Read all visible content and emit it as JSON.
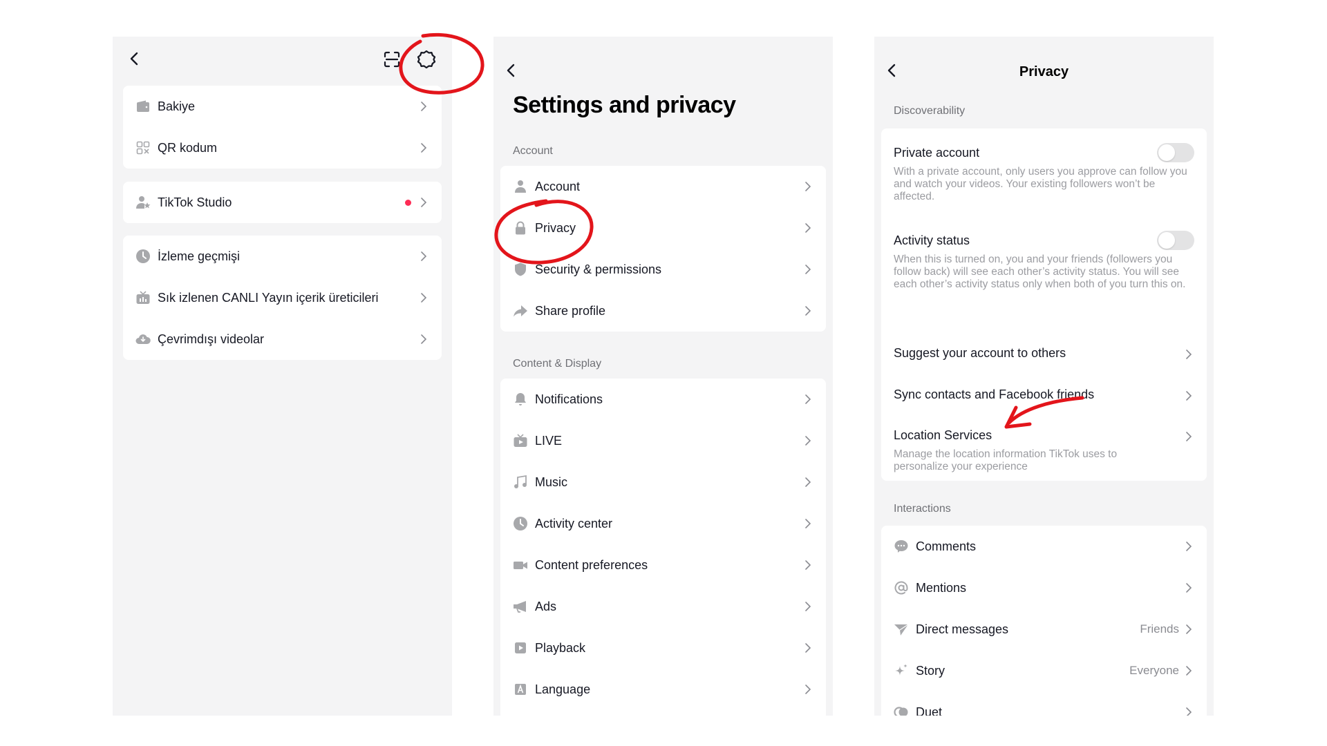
{
  "panel1": {
    "header": {
      "back_icon": "chevron-left-icon",
      "scan_icon": "scan-icon",
      "settings_icon": "gear-icon"
    },
    "groups": [
      [
        {
          "label": "Bakiye",
          "icon": "wallet-icon"
        },
        {
          "label": "QR kodum",
          "icon": "qr-code-icon"
        }
      ],
      [
        {
          "label": "TikTok Studio",
          "icon": "user-star-icon",
          "badge": "red-dot"
        }
      ],
      [
        {
          "label": "İzleme geçmişi",
          "icon": "clock-icon"
        },
        {
          "label": "Sık izlenen CANLI Yayın içerik üreticileri",
          "icon": "live-tv-icon"
        },
        {
          "label": "Çevrimdışı videolar",
          "icon": "cloud-download-icon"
        }
      ]
    ]
  },
  "panel2": {
    "title": "Settings and privacy",
    "sections": [
      {
        "label": "Account",
        "items": [
          {
            "label": "Account",
            "icon": "user-icon"
          },
          {
            "label": "Privacy",
            "icon": "lock-icon"
          },
          {
            "label": "Security & permissions",
            "icon": "shield-icon"
          },
          {
            "label": "Share profile",
            "icon": "share-icon"
          }
        ]
      },
      {
        "label": "Content & Display",
        "items": [
          {
            "label": "Notifications",
            "icon": "bell-icon"
          },
          {
            "label": "LIVE",
            "icon": "live-tv-icon"
          },
          {
            "label": "Music",
            "icon": "music-note-icon"
          },
          {
            "label": "Activity center",
            "icon": "clock-icon"
          },
          {
            "label": "Content preferences",
            "icon": "video-camera-icon"
          },
          {
            "label": "Ads",
            "icon": "megaphone-icon"
          },
          {
            "label": "Playback",
            "icon": "play-icon"
          },
          {
            "label": "Language",
            "icon": "language-icon"
          }
        ]
      }
    ]
  },
  "panel3": {
    "title": "Privacy",
    "discoverability": {
      "label": "Discoverability",
      "private_account": {
        "title": "Private account",
        "desc": "With a private account, only users you approve can follow you and watch your videos. Your existing followers won’t be affected.",
        "enabled": false
      },
      "activity_status": {
        "title": "Activity status",
        "desc": "When this is turned on, you and your friends (followers you follow back) will see each other’s activity status. You will see each other’s activity status only when both of you turn this on.",
        "enabled": false
      },
      "suggest": "Suggest your account to others",
      "sync": "Sync contacts and Facebook friends",
      "location": {
        "title": "Location Services",
        "desc": "Manage the location information TikTok uses to personalize your experience"
      }
    },
    "interactions": {
      "label": "Interactions",
      "items": [
        {
          "label": "Comments",
          "icon": "comment-icon",
          "value": ""
        },
        {
          "label": "Mentions",
          "icon": "at-icon",
          "value": ""
        },
        {
          "label": "Direct messages",
          "icon": "send-icon",
          "value": "Friends"
        },
        {
          "label": "Story",
          "icon": "sparkle-icon",
          "value": "Everyone"
        },
        {
          "label": "Duet",
          "icon": "duet-icon",
          "value": ""
        }
      ]
    }
  },
  "colors": {
    "panel_bg": "#f4f4f5",
    "card_bg": "#ffffff",
    "accent_red": "#fe2c55",
    "annotation_red": "#e3151b",
    "icon_gray": "#a7a8ab"
  }
}
